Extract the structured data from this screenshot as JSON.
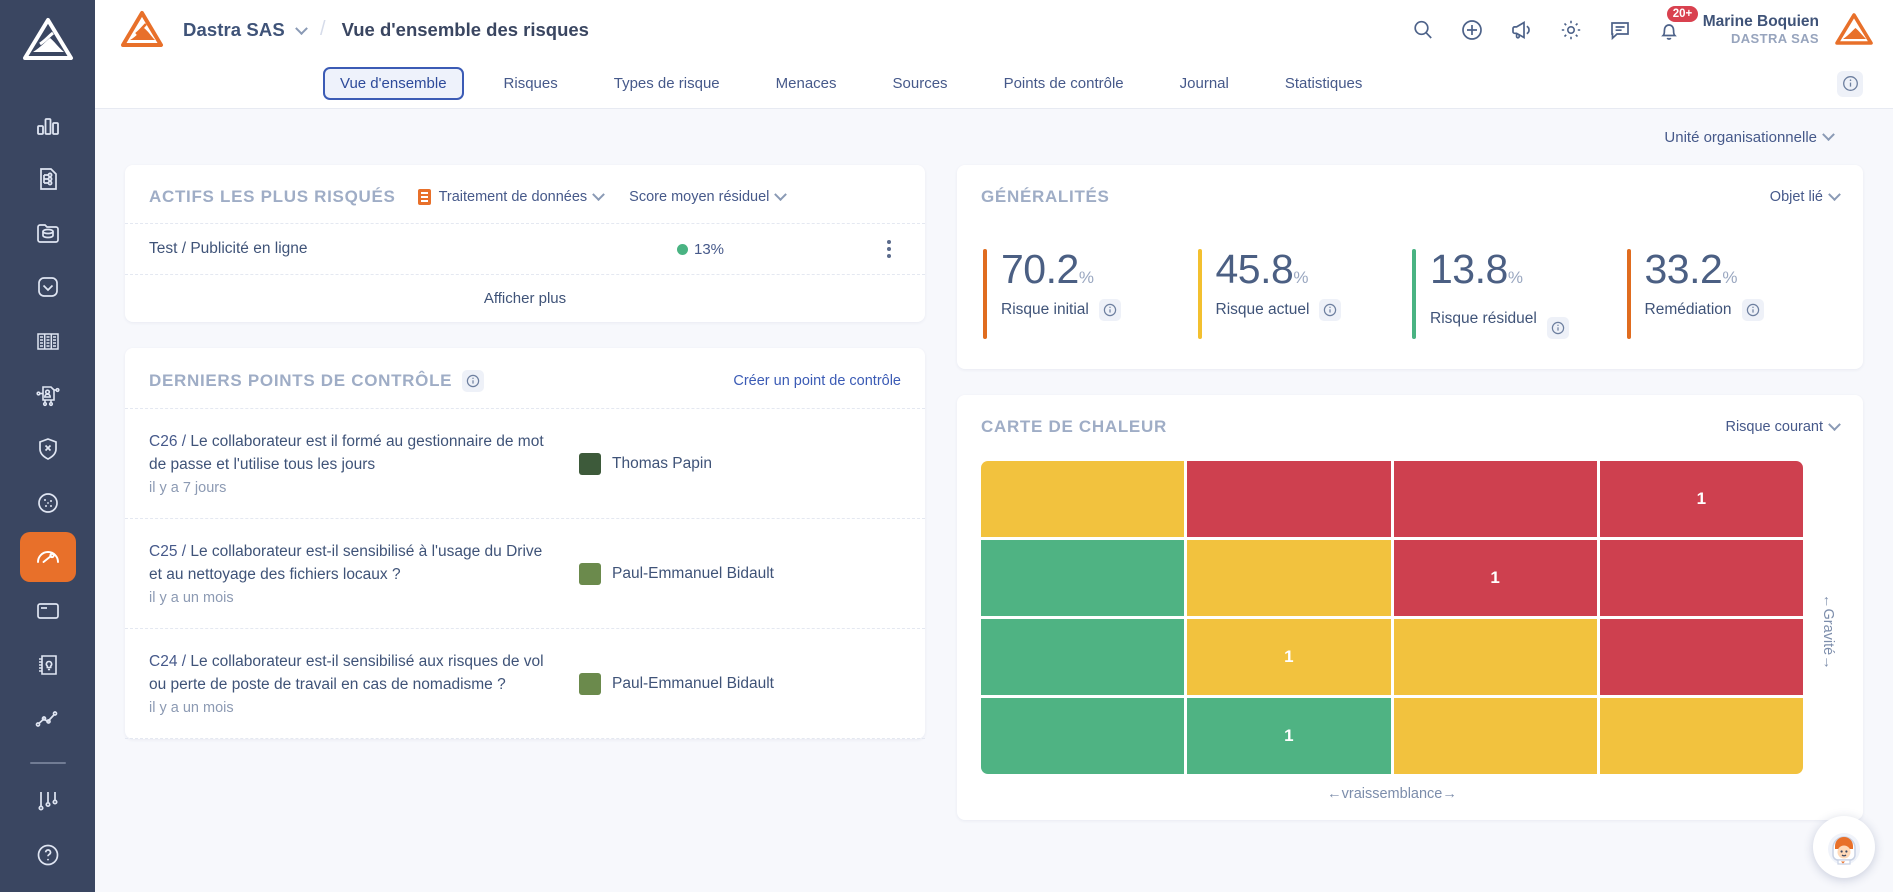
{
  "sidebar": {
    "logo_name": "dastra-logo",
    "items": [
      {
        "name": "sidebar-item-dashboard",
        "icon": "bar-chart-icon",
        "active": false
      },
      {
        "name": "sidebar-item-processing",
        "icon": "document-flow-icon",
        "active": false
      },
      {
        "name": "sidebar-item-data-repository",
        "icon": "folder-database-icon",
        "active": false
      },
      {
        "name": "sidebar-item-compliance",
        "icon": "shield-check-icon",
        "active": false
      },
      {
        "name": "sidebar-item-registry",
        "icon": "columns-table-icon",
        "active": false
      },
      {
        "name": "sidebar-item-subjects",
        "icon": "person-network-icon",
        "active": false
      },
      {
        "name": "sidebar-item-incidents",
        "icon": "shield-x-icon",
        "active": false
      },
      {
        "name": "sidebar-item-cookies",
        "icon": "cookie-icon",
        "active": false
      },
      {
        "name": "sidebar-item-risks",
        "icon": "gauge-icon",
        "active": true
      },
      {
        "name": "sidebar-item-documents",
        "icon": "folder-icon",
        "active": false
      },
      {
        "name": "sidebar-item-notebook",
        "icon": "notebook-idea-icon",
        "active": false
      },
      {
        "name": "sidebar-item-analytics",
        "icon": "line-chart-icon",
        "active": false
      },
      {
        "name": "sidebar-item-settings",
        "icon": "sliders-icon",
        "active": false
      },
      {
        "name": "sidebar-item-help",
        "icon": "question-circle-icon",
        "active": false
      }
    ]
  },
  "header": {
    "brand": "Dastra SAS",
    "separator": "/",
    "page_title": "Vue d'ensemble des risques",
    "icons": [
      {
        "name": "search-icon",
        "label": "search"
      },
      {
        "name": "plus-circle-icon",
        "label": "add"
      },
      {
        "name": "megaphone-icon",
        "label": "announcements"
      },
      {
        "name": "gear-icon",
        "label": "settings"
      },
      {
        "name": "chat-icon",
        "label": "messages"
      },
      {
        "name": "bell-icon",
        "label": "notifications"
      }
    ],
    "notification_badge": "20+",
    "user_name": "Marine Boquien",
    "user_org": "DASTRA SAS"
  },
  "tabs": [
    {
      "label": "Vue d'ensemble",
      "active": true
    },
    {
      "label": "Risques",
      "active": false
    },
    {
      "label": "Types de risque",
      "active": false
    },
    {
      "label": "Menaces",
      "active": false
    },
    {
      "label": "Sources",
      "active": false
    },
    {
      "label": "Points de contrôle",
      "active": false
    },
    {
      "label": "Journal",
      "active": false
    },
    {
      "label": "Statistiques",
      "active": false
    }
  ],
  "filter": {
    "org_unit_label": "Unité organisationnelle"
  },
  "assets_card": {
    "title": "ACTIFS LES PLUS RISQUÉS",
    "type_filter": "Traitement de données",
    "score_filter": "Score moyen résiduel",
    "rows": [
      {
        "name": "Test / Publicité en ligne",
        "score": "13%",
        "color": "#49b382"
      }
    ],
    "footer_label": "Afficher plus"
  },
  "control_points_card": {
    "title": "DERNIERS POINTS DE CONTRÔLE",
    "create_label": "Créer un point de contrôle",
    "rows": [
      {
        "code": "C26 /",
        "text": "Le collaborateur est il formé au gestionnaire de mot de passe et l'utilise tous les jours",
        "ago": "il y a 7 jours",
        "user": "Thomas Papin",
        "avatar_color": "#3d5a3a"
      },
      {
        "code": "C25 /",
        "text": "Le collaborateur est-il sensibilisé à l'usage du Drive et au nettoyage des fichiers locaux ?",
        "ago": "il y a un mois",
        "user": "Paul-Emmanuel Bidault",
        "avatar_color": "#6b8a4c"
      },
      {
        "code": "C24 /",
        "text": "Le collaborateur est-il sensibilisé aux risques de vol ou perte de poste de travail en cas de nomadisme ?",
        "ago": "il y a un mois",
        "user": "Paul-Emmanuel Bidault",
        "avatar_color": "#6b8a4c"
      }
    ]
  },
  "generalities_card": {
    "title": "GÉNÉRALITÉS",
    "object_filter": "Objet lié",
    "stats": [
      {
        "value": "70.2",
        "unit": "%",
        "label": "Risque initial",
        "color": "#e06c1f",
        "has_info": true
      },
      {
        "value": "45.8",
        "unit": "%",
        "label": "Risque actuel",
        "color": "#f3c02f",
        "has_info": true
      },
      {
        "value": "13.8",
        "unit": "%",
        "label": "Risque résiduel",
        "color": "#49b382",
        "has_info": true
      },
      {
        "value": "33.2",
        "unit": "%",
        "label": "Remédiation",
        "color": "#e06c1f",
        "has_info": true
      }
    ]
  },
  "heatmap_card": {
    "title": "CARTE DE CHALEUR",
    "risk_filter": "Risque courant",
    "x_axis_label": "←vraissemblance→",
    "y_axis_label": "←Gravité→"
  },
  "chart_data": {
    "type": "heatmap",
    "title": "CARTE DE CHALEUR",
    "xlabel": "←vraissemblance→",
    "ylabel": "←Gravité→",
    "rows": 4,
    "cols": 4,
    "colors": {
      "green": "#4fb383",
      "yellow": "#f2c23e",
      "red": "#ce404f"
    },
    "cells": [
      [
        {
          "color": "yellow",
          "value": ""
        },
        {
          "color": "red",
          "value": ""
        },
        {
          "color": "red",
          "value": ""
        },
        {
          "color": "red",
          "value": "1"
        }
      ],
      [
        {
          "color": "green",
          "value": ""
        },
        {
          "color": "yellow",
          "value": ""
        },
        {
          "color": "red",
          "value": "1"
        },
        {
          "color": "red",
          "value": ""
        }
      ],
      [
        {
          "color": "green",
          "value": ""
        },
        {
          "color": "yellow",
          "value": "1"
        },
        {
          "color": "yellow",
          "value": ""
        },
        {
          "color": "red",
          "value": ""
        }
      ],
      [
        {
          "color": "green",
          "value": ""
        },
        {
          "color": "green",
          "value": "1"
        },
        {
          "color": "yellow",
          "value": ""
        },
        {
          "color": "yellow",
          "value": ""
        }
      ]
    ]
  }
}
